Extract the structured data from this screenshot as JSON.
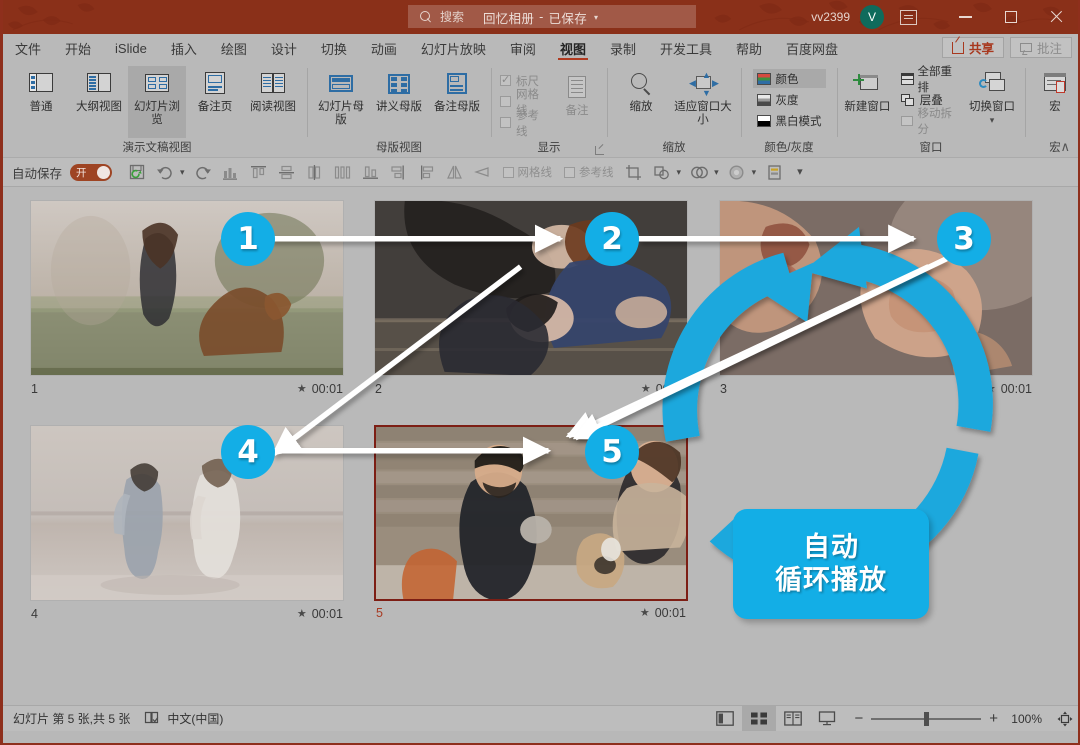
{
  "titlebar": {
    "doc_title": "回忆相册",
    "saved_status": "已保存",
    "caret": "▾",
    "search_placeholder": "搜索",
    "account_name": "vv2399",
    "avatar_initial": "V",
    "ribbon_display_icon": "ribbon-display-options-icon",
    "minimize_icon": "minimize-icon",
    "maximize_icon": "maximize-icon",
    "close_icon": "close-icon",
    "bg_color": "#8a3019"
  },
  "tabs": [
    {
      "label": "文件",
      "active": false
    },
    {
      "label": "开始",
      "active": false
    },
    {
      "label": "iSlide",
      "active": false
    },
    {
      "label": "插入",
      "active": false
    },
    {
      "label": "绘图",
      "active": false
    },
    {
      "label": "设计",
      "active": false
    },
    {
      "label": "切换",
      "active": false
    },
    {
      "label": "动画",
      "active": false
    },
    {
      "label": "幻灯片放映",
      "active": false
    },
    {
      "label": "审阅",
      "active": false
    },
    {
      "label": "视图",
      "active": true
    },
    {
      "label": "录制",
      "active": false
    },
    {
      "label": "开发工具",
      "active": false
    },
    {
      "label": "帮助",
      "active": false
    },
    {
      "label": "百度网盘",
      "active": false
    }
  ],
  "tab_actions": {
    "share_label": "共享",
    "comment_label": "批注"
  },
  "ribbon": {
    "groups": [
      {
        "title": "演示文稿视图",
        "buttons": [
          {
            "label": "普通",
            "icon": "normal-view-icon",
            "selected": false
          },
          {
            "label": "大纲视图",
            "icon": "outline-view-icon",
            "selected": false
          },
          {
            "label": "幻灯片浏览",
            "icon": "slide-sorter-icon",
            "selected": true
          },
          {
            "label": "备注页",
            "icon": "notes-page-icon",
            "selected": false
          },
          {
            "label": "阅读视图",
            "icon": "reading-view-icon",
            "selected": false
          }
        ]
      },
      {
        "title": "母版视图",
        "buttons": [
          {
            "label": "幻灯片母版",
            "icon": "slide-master-icon",
            "selected": false
          },
          {
            "label": "讲义母版",
            "icon": "handout-master-icon",
            "selected": false
          },
          {
            "label": "备注母版",
            "icon": "notes-master-icon",
            "selected": false
          }
        ]
      },
      {
        "title": "显示",
        "checkboxes": [
          {
            "label": "标尺",
            "checked": true
          },
          {
            "label": "网格线",
            "checked": false
          },
          {
            "label": "参考线",
            "checked": false
          }
        ],
        "buttons": [
          {
            "label": "备注",
            "icon": "notes-icon",
            "selected": false
          }
        ],
        "has_dialog_launcher": true
      },
      {
        "title": "缩放",
        "buttons": [
          {
            "label": "缩放",
            "icon": "zoom-icon",
            "selected": false
          },
          {
            "label": "适应窗口大小",
            "icon": "fit-to-window-icon",
            "selected": false
          }
        ]
      },
      {
        "title": "颜色/灰度",
        "options": [
          {
            "label": "颜色",
            "swatch": "sw-color",
            "selected": true
          },
          {
            "label": "灰度",
            "swatch": "sw-gray",
            "selected": false
          },
          {
            "label": "黑白模式",
            "swatch": "sw-bw",
            "selected": false
          }
        ]
      },
      {
        "title": "窗口",
        "buttons": [
          {
            "label": "新建窗口",
            "icon": "new-window-icon",
            "selected": false
          },
          {
            "label": "切换窗口",
            "icon": "switch-window-icon",
            "selected": false
          }
        ],
        "options": [
          {
            "label": "全部重排",
            "enabled": true
          },
          {
            "label": "层叠",
            "enabled": true
          },
          {
            "label": "移动拆分",
            "enabled": false
          }
        ]
      },
      {
        "title": "宏",
        "buttons": [
          {
            "label": "宏",
            "icon": "macro-icon",
            "selected": false
          }
        ]
      }
    ],
    "collapse_label": "∧"
  },
  "qat": {
    "autosave_label": "自动保存",
    "autosave_state": "开",
    "autosave_on": true,
    "buttons": [
      {
        "name": "save-icon"
      },
      {
        "name": "undo-icon",
        "has_caret": true
      },
      {
        "name": "redo-icon"
      },
      {
        "name": "chart-icon"
      },
      {
        "name": "align-top-icon"
      },
      {
        "name": "align-middle-icon"
      },
      {
        "name": "align-center-icon"
      },
      {
        "name": "distribute-horizontal-icon"
      },
      {
        "name": "align-bottom-icon"
      },
      {
        "name": "align-right-icon"
      },
      {
        "name": "align-left-icon"
      },
      {
        "name": "flip-horizontal-icon"
      },
      {
        "name": "flip-vertical-icon"
      }
    ],
    "checkboxes": [
      {
        "label": "网格线",
        "checked": false
      },
      {
        "label": "参考线",
        "checked": false
      }
    ],
    "buttons2": [
      {
        "name": "crop-icon"
      },
      {
        "name": "merge-shapes-icon",
        "has_caret": true
      },
      {
        "name": "shape-intersect-icon",
        "has_caret": true
      },
      {
        "name": "shape-fill-icon",
        "has_caret": true
      },
      {
        "name": "selection-pane-icon"
      }
    ],
    "overflow_label": "▾"
  },
  "slides": [
    {
      "num": "1",
      "duration": "00:01",
      "selected": false,
      "transition_star": "★"
    },
    {
      "num": "2",
      "duration": "00:01",
      "selected": false,
      "transition_star": "★"
    },
    {
      "num": "3",
      "duration": "00:01",
      "selected": false,
      "transition_star": "★"
    },
    {
      "num": "4",
      "duration": "00:01",
      "selected": false,
      "transition_star": "★"
    },
    {
      "num": "5",
      "duration": "00:01",
      "selected": true,
      "transition_star": "★"
    }
  ],
  "annotations": {
    "accent_color": "#13aee6",
    "badges": [
      {
        "label": "1"
      },
      {
        "label": "2"
      },
      {
        "label": "3"
      },
      {
        "label": "4"
      },
      {
        "label": "5"
      }
    ],
    "callout": {
      "line1": "自动",
      "line2": "循环播放"
    }
  },
  "statusbar": {
    "slide_count_text": "幻灯片 第 5 张,共 5 张",
    "proofing_icon": "proofing-icon",
    "language": "中文(中国)",
    "view_buttons": [
      {
        "name": "normal-view-button",
        "active": false
      },
      {
        "name": "slide-sorter-button",
        "active": true
      },
      {
        "name": "reading-view-button",
        "active": false
      },
      {
        "name": "slideshow-button",
        "active": false
      }
    ],
    "zoom_out_label": "−",
    "zoom_in_label": "+",
    "zoom_level": "100%",
    "fit_slide_icon": "fit-slide-to-window-icon"
  }
}
